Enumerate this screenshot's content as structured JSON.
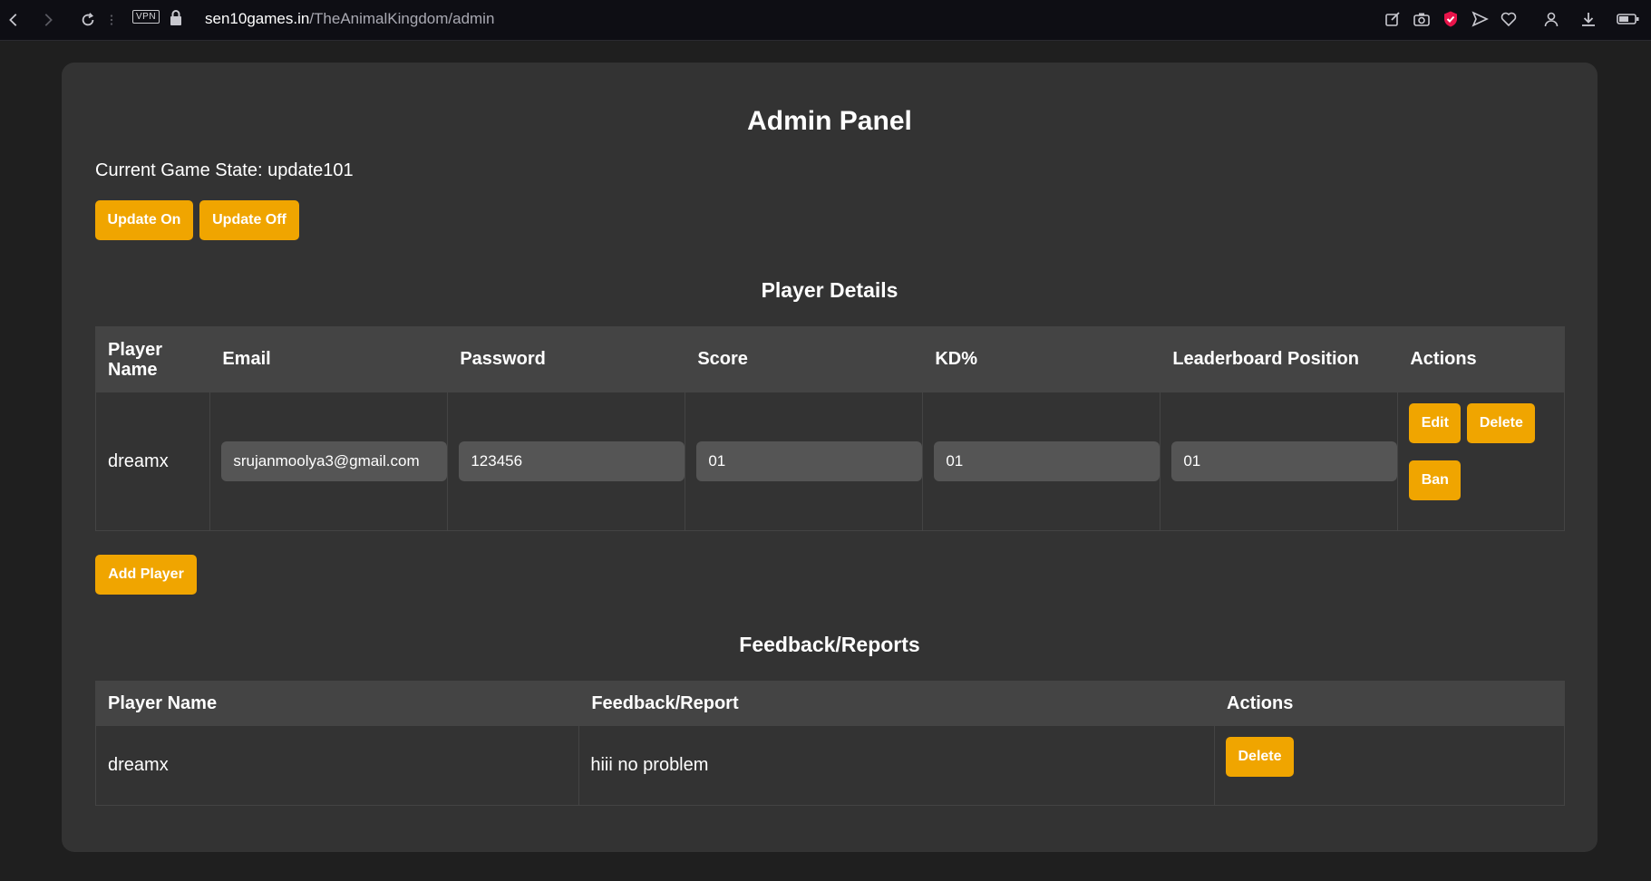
{
  "browser": {
    "vpn_label": "VPN",
    "url_host": "sen10games.in",
    "url_path": "/TheAnimalKingdom/admin",
    "icons": [
      "back-icon",
      "forward-icon",
      "reload-icon",
      "menu-dots-icon",
      "vpn-badge",
      "lock-icon",
      "edit-icon",
      "camera-icon",
      "shield-icon",
      "send-icon",
      "heart-icon",
      "user-icon",
      "download-icon",
      "battery-icon"
    ]
  },
  "admin": {
    "title": "Admin Panel",
    "game_state_label": "Current Game State: update101",
    "update_on": "Update On",
    "update_off": "Update Off"
  },
  "players": {
    "section_title": "Player Details",
    "columns": [
      "Player Name",
      "Email",
      "Password",
      "Score",
      "KD%",
      "Leaderboard Position",
      "Actions"
    ],
    "rows": [
      {
        "name": "dreamx",
        "email": "srujanmoolya3@gmail.com",
        "password": "123456",
        "score": "01",
        "kd": "01",
        "leaderboard": "01",
        "actions": {
          "edit": "Edit",
          "delete": "Delete",
          "ban": "Ban"
        }
      }
    ],
    "add_player": "Add Player"
  },
  "feedback": {
    "section_title": "Feedback/Reports",
    "columns": [
      "Player Name",
      "Feedback/Report",
      "Actions"
    ],
    "rows": [
      {
        "name": "dreamx",
        "report": "hiii no problem",
        "delete": "Delete"
      }
    ]
  },
  "colors": {
    "accent": "#f0a500",
    "panel": "#333333",
    "background": "#1f1f1f",
    "header_cell": "#444444",
    "input": "#555555"
  }
}
